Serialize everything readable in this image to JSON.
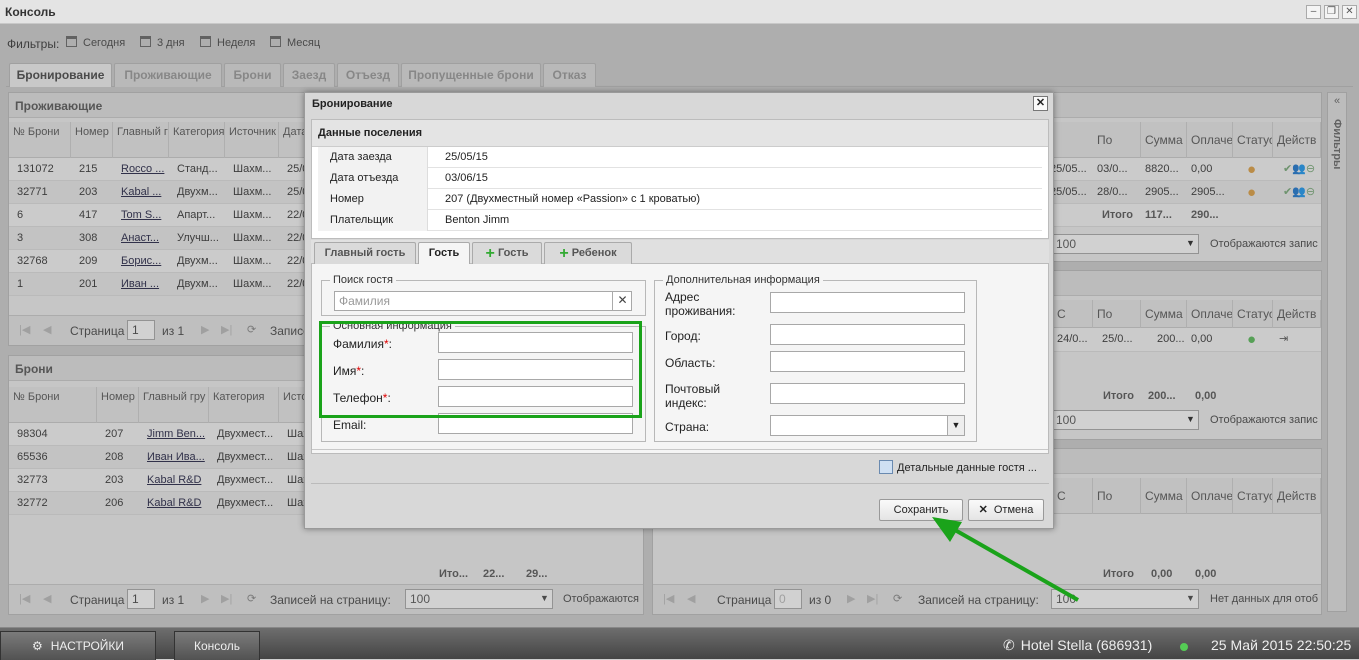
{
  "window": {
    "title": "Консоль"
  },
  "filters": {
    "label": "Фильтры:",
    "items": [
      "Сегодня",
      "3 дня",
      "Неделя",
      "Месяц"
    ]
  },
  "main_tabs": [
    "Бронирование",
    "Проживающие",
    "Брони",
    "Заезд",
    "Отъезд",
    "Пропущенные брони",
    "Отказ"
  ],
  "side_panel": {
    "label": "Фильтры"
  },
  "residents_panel": {
    "title": "Проживающие",
    "headers": [
      "№ Брони",
      "Номер",
      "Главный г",
      "Категория",
      "Источник",
      "Дата"
    ],
    "rows": [
      [
        "131072",
        "215",
        "Rocco ...",
        "Станд...",
        "Шахм...",
        "25/0"
      ],
      [
        "32771",
        "203",
        "Kabal ...",
        "Двухм...",
        "Шахм...",
        "25/0"
      ],
      [
        "6",
        "417",
        "Tom S...",
        "Апарт...",
        "Шахм...",
        "22/0"
      ],
      [
        "3",
        "308",
        "Анаст...",
        "Улучш...",
        "Шахм...",
        "22/0"
      ],
      [
        "32768",
        "209",
        "Борис...",
        "Двухм...",
        "Шахм...",
        "22/0"
      ],
      [
        "1",
        "201",
        "Иван ...",
        "Двухм...",
        "Шахм...",
        "22/0"
      ]
    ],
    "pager": {
      "page_label": "Страница",
      "page": "1",
      "of": "из 1",
      "per_page_label": "Записе"
    }
  },
  "bookings_panel": {
    "title": "Брони",
    "headers": [
      "№ Брони",
      "Номер",
      "Главный гру",
      "Категория",
      "Исто"
    ],
    "rows": [
      [
        "98304",
        "207",
        "Jimm Ben...",
        "Двухмест...",
        "Шах"
      ],
      [
        "65536",
        "208",
        "Иван Ива...",
        "Двухмест...",
        "Шах"
      ],
      [
        "32773",
        "203",
        "Kabal R&D",
        "Двухмест...",
        "Шах"
      ],
      [
        "32772",
        "206",
        "Kabal R&D",
        "Двухмест...",
        "Шах"
      ]
    ],
    "totals": [
      "Ито...",
      "22...",
      "29..."
    ],
    "pager": {
      "page_label": "Страница",
      "page": "1",
      "of": "из 1",
      "per_page_label": "Записей на страницу:",
      "per_page": "100",
      "status": "Отображаются"
    }
  },
  "right_top": {
    "headers": [
      "По",
      "Сумма",
      "Оплаче",
      "Статус",
      "Действ"
    ],
    "rows": [
      [
        "25/05...",
        "03/0...",
        "8820...",
        "0,00"
      ],
      [
        "25/05...",
        "28/0...",
        "2905...",
        "2905..."
      ]
    ],
    "totals": [
      "Итого",
      "117...",
      "290..."
    ],
    "per_page": "100",
    "status": "Отображаются запис"
  },
  "right_mid": {
    "headers": [
      "С",
      "По",
      "Сумма",
      "Оплаче",
      "Статус",
      "Действ"
    ],
    "row": [
      "24/0...",
      "25/0...",
      "200...",
      "0,00"
    ],
    "totals": [
      "Итого",
      "200...",
      "0,00"
    ],
    "per_page": "100",
    "status": "Отображаются запис"
  },
  "right_bot": {
    "headers": [
      "С",
      "По",
      "Сумма",
      "Оплаче",
      "Статус",
      "Действ"
    ],
    "totals": [
      "Итого",
      "0,00",
      "0,00"
    ],
    "pager": {
      "page_label": "Страница",
      "page": "0",
      "of": "из 0",
      "per_page_label": "Записей на страницу:",
      "per_page": "100",
      "status": "Нет данных для отоб"
    }
  },
  "dialog": {
    "title": "Бронирование",
    "section_title": "Данные поселения",
    "details": [
      {
        "k": "Дата заезда",
        "v": "25/05/15"
      },
      {
        "k": "Дата отъезда",
        "v": "03/06/15"
      },
      {
        "k": "Номер",
        "v": "207 (Двухместный номер «Passion» с 1 кроватью)"
      },
      {
        "k": "Плательщик",
        "v": "Benton Jimm"
      }
    ],
    "tabs": [
      "Главный гость",
      "Гость",
      "Гость",
      "Ребенок"
    ],
    "search": {
      "legend": "Поиск гостя",
      "placeholder": "Фамилия"
    },
    "basic": {
      "legend": "Основная информация",
      "surname": "Фамилия",
      "name": "Имя",
      "phone": "Телефон",
      "email": "Email:",
      "req": "*",
      "colon": ":"
    },
    "extra": {
      "legend": "Дополнительная информация",
      "address": "Адрес проживания:",
      "city": "Город:",
      "region": "Область:",
      "postal": "Почтовый индекс:",
      "country": "Страна:"
    },
    "details_link": "Детальные данные гостя ...",
    "save": "Сохранить",
    "cancel": "Отмена"
  },
  "taskbar": {
    "settings": "НАСТРОЙКИ",
    "console": "Консоль",
    "hotel": "Hotel Stella (686931)",
    "datetime": "25 Май 2015 22:50:25"
  },
  "colors": {
    "highlight": "#1aa31a",
    "arrow": "#1aa31a"
  }
}
